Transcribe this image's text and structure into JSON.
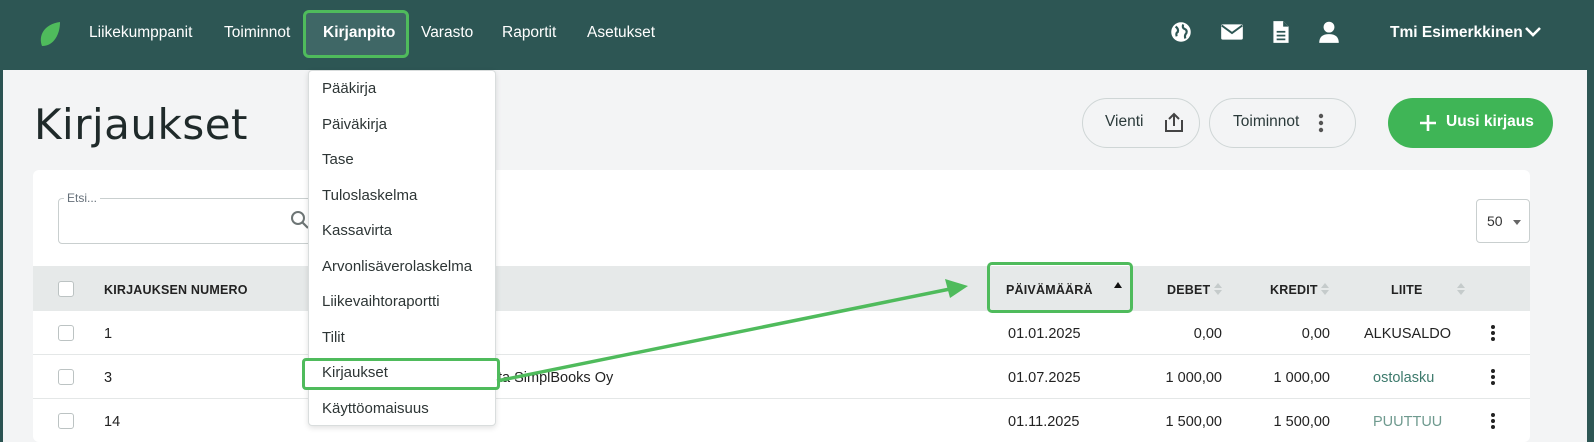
{
  "nav": {
    "items": [
      "Liikekumppanit",
      "Toiminnot",
      "Kirjanpito",
      "Varasto",
      "Raportit",
      "Asetukset"
    ],
    "active": "Kirjanpito",
    "user_name": "Tmi Esimerkkinen",
    "icons": [
      "globe-icon",
      "mail-icon",
      "document-icon",
      "user-icon"
    ]
  },
  "page": {
    "title": "Kirjaukset",
    "export_label": "Vienti",
    "actions_label": "Toiminnot",
    "new_entry_label": "Uusi kirjaus"
  },
  "search": {
    "label": "Etsi..."
  },
  "per_page": "50",
  "table": {
    "columns": [
      "KIRJAUKSEN NUMERO",
      "PÄIVÄMÄÄRÄ",
      "DEBET",
      "KREDIT",
      "LIITE"
    ],
    "rows": [
      {
        "number": "1",
        "description": "",
        "date": "01.01.2025",
        "debit": "0,00",
        "credit": "0,00",
        "attachment": "ALKUSALDO"
      },
      {
        "number": "3",
        "description": "ta SimplBooks Oy",
        "date": "01.07.2025",
        "debit": "1 000,00",
        "credit": "1 000,00",
        "attachment": "ostolasku"
      },
      {
        "number": "14",
        "description": "",
        "date": "01.11.2025",
        "debit": "1 500,00",
        "credit": "1 500,00",
        "attachment": "PUUTTUU"
      }
    ]
  },
  "dropdown": {
    "items": [
      "Pääkirja",
      "Päiväkirja",
      "Tase",
      "Tuloslaskelma",
      "Kassavirta",
      "Arvonlisäverolaskelma",
      "Liikevaihtoraportti",
      "Tilit",
      "Kirjaukset",
      "Käyttöomaisuus"
    ],
    "highlighted": "Kirjaukset"
  },
  "colors": {
    "nav_bg": "#2d5654",
    "primary": "#3fb556",
    "highlight": "#4fbb5c",
    "attachment_link": "#3d7a6c"
  }
}
